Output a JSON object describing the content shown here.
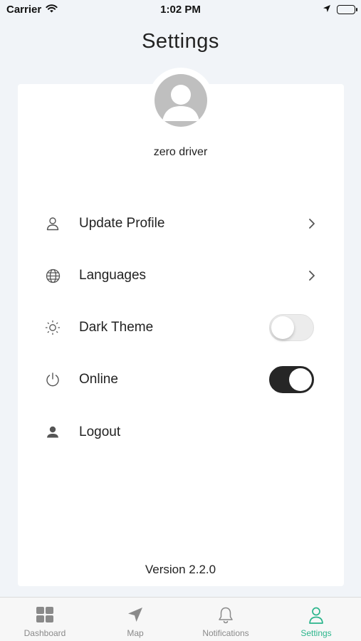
{
  "status_bar": {
    "carrier": "Carrier",
    "time": "1:02 PM"
  },
  "page": {
    "title": "Settings"
  },
  "profile": {
    "name": "zero driver"
  },
  "menu": {
    "update_profile": {
      "label": "Update Profile",
      "icon": "user-outline-icon"
    },
    "languages": {
      "label": "Languages",
      "icon": "globe-icon"
    },
    "dark_theme": {
      "label": "Dark Theme",
      "icon": "sun-icon",
      "enabled": false
    },
    "online": {
      "label": "Online",
      "icon": "power-icon",
      "enabled": true
    },
    "logout": {
      "label": "Logout",
      "icon": "user-filled-icon"
    }
  },
  "footer": {
    "version": "Version 2.2.0"
  },
  "tabs": [
    {
      "label": "Dashboard",
      "icon": "grid-icon",
      "active": false
    },
    {
      "label": "Map",
      "icon": "navigation-arrow-icon",
      "active": false
    },
    {
      "label": "Notifications",
      "icon": "bell-icon",
      "active": false
    },
    {
      "label": "Settings",
      "icon": "user-outline-icon",
      "active": true
    }
  ],
  "colors": {
    "background": "#f1f4f8",
    "card": "#ffffff",
    "accent": "#2bb58c",
    "toggle_on": "#262626",
    "tab_inactive": "#8a8a8a"
  }
}
